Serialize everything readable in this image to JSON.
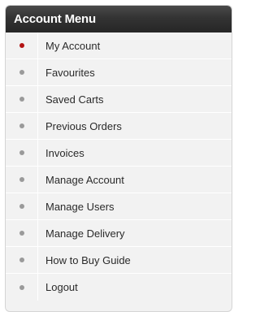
{
  "menu": {
    "title": "Account Menu",
    "items": [
      {
        "label": "My Account",
        "active": true
      },
      {
        "label": "Favourites",
        "active": false
      },
      {
        "label": "Saved Carts",
        "active": false
      },
      {
        "label": "Previous Orders",
        "active": false
      },
      {
        "label": "Invoices",
        "active": false
      },
      {
        "label": "Manage Account",
        "active": false
      },
      {
        "label": "Manage Users",
        "active": false
      },
      {
        "label": "Manage Delivery",
        "active": false
      },
      {
        "label": "How to Buy Guide",
        "active": false
      },
      {
        "label": "Logout",
        "active": false
      }
    ]
  },
  "colors": {
    "header_background": "#333333",
    "header_text": "#ffffff",
    "panel_background": "#f2f2f2",
    "bullet_default": "#9a9a9a",
    "bullet_active": "#b31313",
    "item_text": "#2a2a2a"
  },
  "icons": {
    "bullet": "bullet-dot-icon"
  }
}
